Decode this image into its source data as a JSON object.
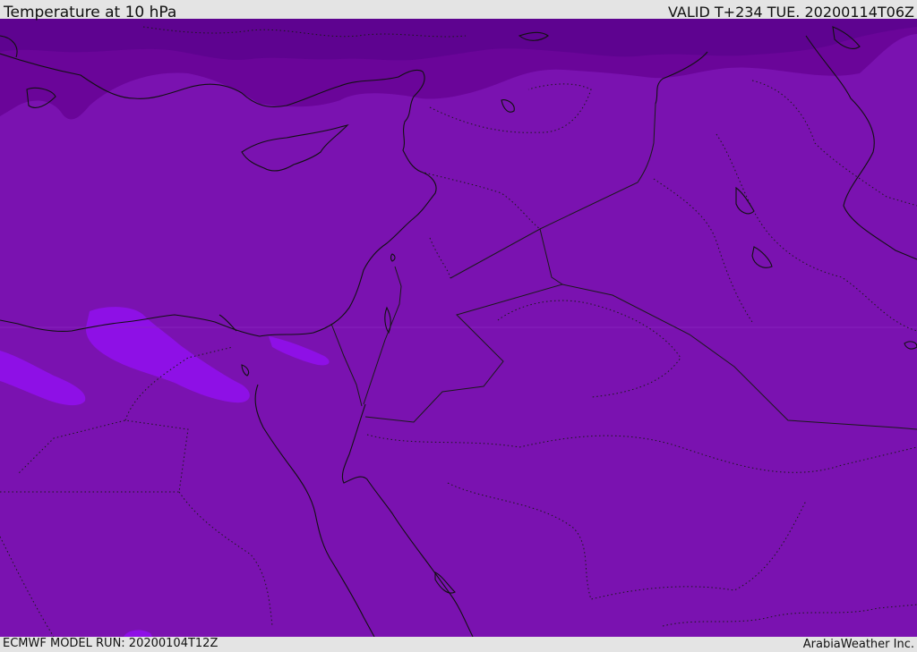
{
  "header": {
    "title": "Temperature at 10 hPa",
    "valid": "VALID T+234 TUE. 20200114T06Z"
  },
  "footer": {
    "model_run": "ECMWF MODEL RUN: 20200104T12Z",
    "credit": "ArabiaWeather Inc."
  },
  "map": {
    "field": "temperature",
    "level": "10 hPa",
    "colors": {
      "base_fill": "#7a12b0",
      "cold_band": "#6a0599",
      "cold_core": "#5e0390",
      "warm_patch": "#8e10e6",
      "coastline": "#111111",
      "border": "#1a1a1a"
    }
  }
}
